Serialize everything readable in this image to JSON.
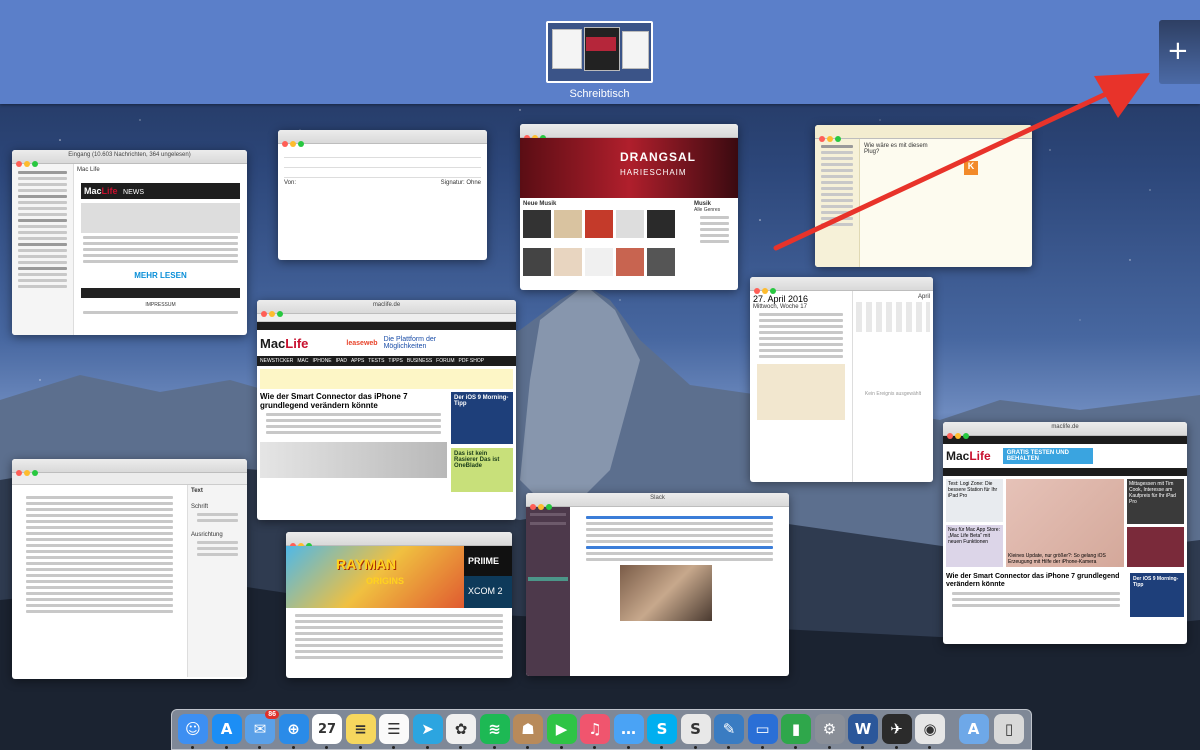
{
  "spaces": {
    "desktop_label": "Schreibtisch",
    "add_space_symbol": "+"
  },
  "windows": {
    "mail_left": {
      "title": "Eingang (10.603 Nachrichten, 364 ungelesen)",
      "logo_mac": "Mac",
      "logo_life": "Life",
      "logo_suffix": "NEWS",
      "from": "Mac Life",
      "button": "MEHR LESEN",
      "footer": "IMPRESSUM"
    },
    "compose": {
      "field_from": "Von:",
      "signature": "Signatur: Ohne"
    },
    "itunes": {
      "banner_title": "DRANGSAL",
      "banner_subtitle": "HARIESCHAIM",
      "section": "Neue Musik",
      "sidebar_title": "Musik",
      "sidebar_sub": "Alle Genres"
    },
    "notes": {
      "label": "Wie wäre es mit diesem Plug?",
      "icon_letter": "K"
    },
    "safari_main": {
      "url": "maclife.de",
      "ad_text": "Die Plattform der Möglichkeiten",
      "ad_brand": "leaseweb",
      "nav": [
        "NEWSTICKER",
        "MAC",
        "IPHONE",
        "IPAD",
        "APPS",
        "TESTS",
        "TIPPS",
        "BUSINESS",
        "FORUM",
        "PDF SHOP"
      ],
      "headline": "Wie der Smart Connector das iPhone 7 grundlegend verändern könnte",
      "side_ad_title": "Der iOS 9 Morning-Tipp",
      "side_ad_2": "Das ist kein Rasierer Das ist OneBlade"
    },
    "calendar": {
      "date": "27. April 2016",
      "weekday": "Mittwoch, Woche 17",
      "empty": "Kein Ereignis ausgewählt",
      "month": "April"
    },
    "pages": {
      "title": "Text",
      "section1": "Schrift",
      "section2": "Ausrichtung"
    },
    "appstore": {
      "banner": "RAYMAN",
      "banner_sub": "ORIGINS",
      "promo": "PRIIME",
      "promo2": "XCOM 2"
    },
    "messages": {
      "title": "Slack"
    },
    "safari_right": {
      "url": "maclife.de",
      "ad": "GRATIS TESTEN UND BEHALTEN",
      "headline": "Wie der Smart Connector das iPhone 7 grundlegend verändern könnte",
      "side": "Der iOS 9 Morning-Tipp",
      "card1": "Test: Logi Zone: Die bessere Station für Ihr iPad Pro",
      "card2": "Mittagessen mit Tim Cook, Interesse am Kaufpreis für Ihr iPad Pro",
      "card3": "Neu für Mac App Store: „Mac Life Beta“ mit neuen Funktionen",
      "card4": "Kleines Update, nur größer?: So gelang iOS Erzeugung mit Hilfe der iPhone-Kamera"
    }
  },
  "dock": {
    "items": [
      {
        "name": "finder",
        "color": "#3d8ff2",
        "glyph": "☺"
      },
      {
        "name": "app-store",
        "color": "#1c8ef5",
        "glyph": "A"
      },
      {
        "name": "mail",
        "color": "#5aa0e8",
        "glyph": "✉",
        "badge": "86"
      },
      {
        "name": "safari",
        "color": "#2a8be8",
        "glyph": "⊕"
      },
      {
        "name": "calendar",
        "color": "#ffffff",
        "glyph": "27"
      },
      {
        "name": "notes",
        "color": "#f6d75e",
        "glyph": "≡"
      },
      {
        "name": "reminders",
        "color": "#fafafa",
        "glyph": "☰"
      },
      {
        "name": "telegram",
        "color": "#2ca5e0",
        "glyph": "➤"
      },
      {
        "name": "photos",
        "color": "#f0f0f0",
        "glyph": "✿"
      },
      {
        "name": "spotify",
        "color": "#1db954",
        "glyph": "≋"
      },
      {
        "name": "contacts",
        "color": "#b88a5a",
        "glyph": "☗"
      },
      {
        "name": "facetime",
        "color": "#2ec445",
        "glyph": "▶"
      },
      {
        "name": "itunes",
        "color": "#f0556e",
        "glyph": "♫"
      },
      {
        "name": "messages",
        "color": "#4aa3f5",
        "glyph": "…"
      },
      {
        "name": "skype",
        "color": "#00aff0",
        "glyph": "S"
      },
      {
        "name": "slack",
        "color": "#e8e8e8",
        "glyph": "S"
      },
      {
        "name": "scrivener",
        "color": "#3a7cc2",
        "glyph": "✎"
      },
      {
        "name": "keynote",
        "color": "#2a6fd6",
        "glyph": "▭"
      },
      {
        "name": "numbers",
        "color": "#2fa74b",
        "glyph": "▮"
      },
      {
        "name": "system-preferences",
        "color": "#8a8f98",
        "glyph": "⚙"
      },
      {
        "name": "word",
        "color": "#2b579a",
        "glyph": "W"
      },
      {
        "name": "rocket",
        "color": "#2b2b2b",
        "glyph": "✈"
      },
      {
        "name": "chrome",
        "color": "#e6e6e6",
        "glyph": "◉"
      },
      {
        "name": "applications-folder",
        "color": "#6ea8e8",
        "glyph": "A"
      },
      {
        "name": "trash",
        "color": "#d9d9d9",
        "glyph": "▯"
      }
    ]
  },
  "colors": {
    "spaces_bar": "#5b7fc9",
    "arrow": "#e8332a",
    "maclife_red": "#c8102e"
  }
}
